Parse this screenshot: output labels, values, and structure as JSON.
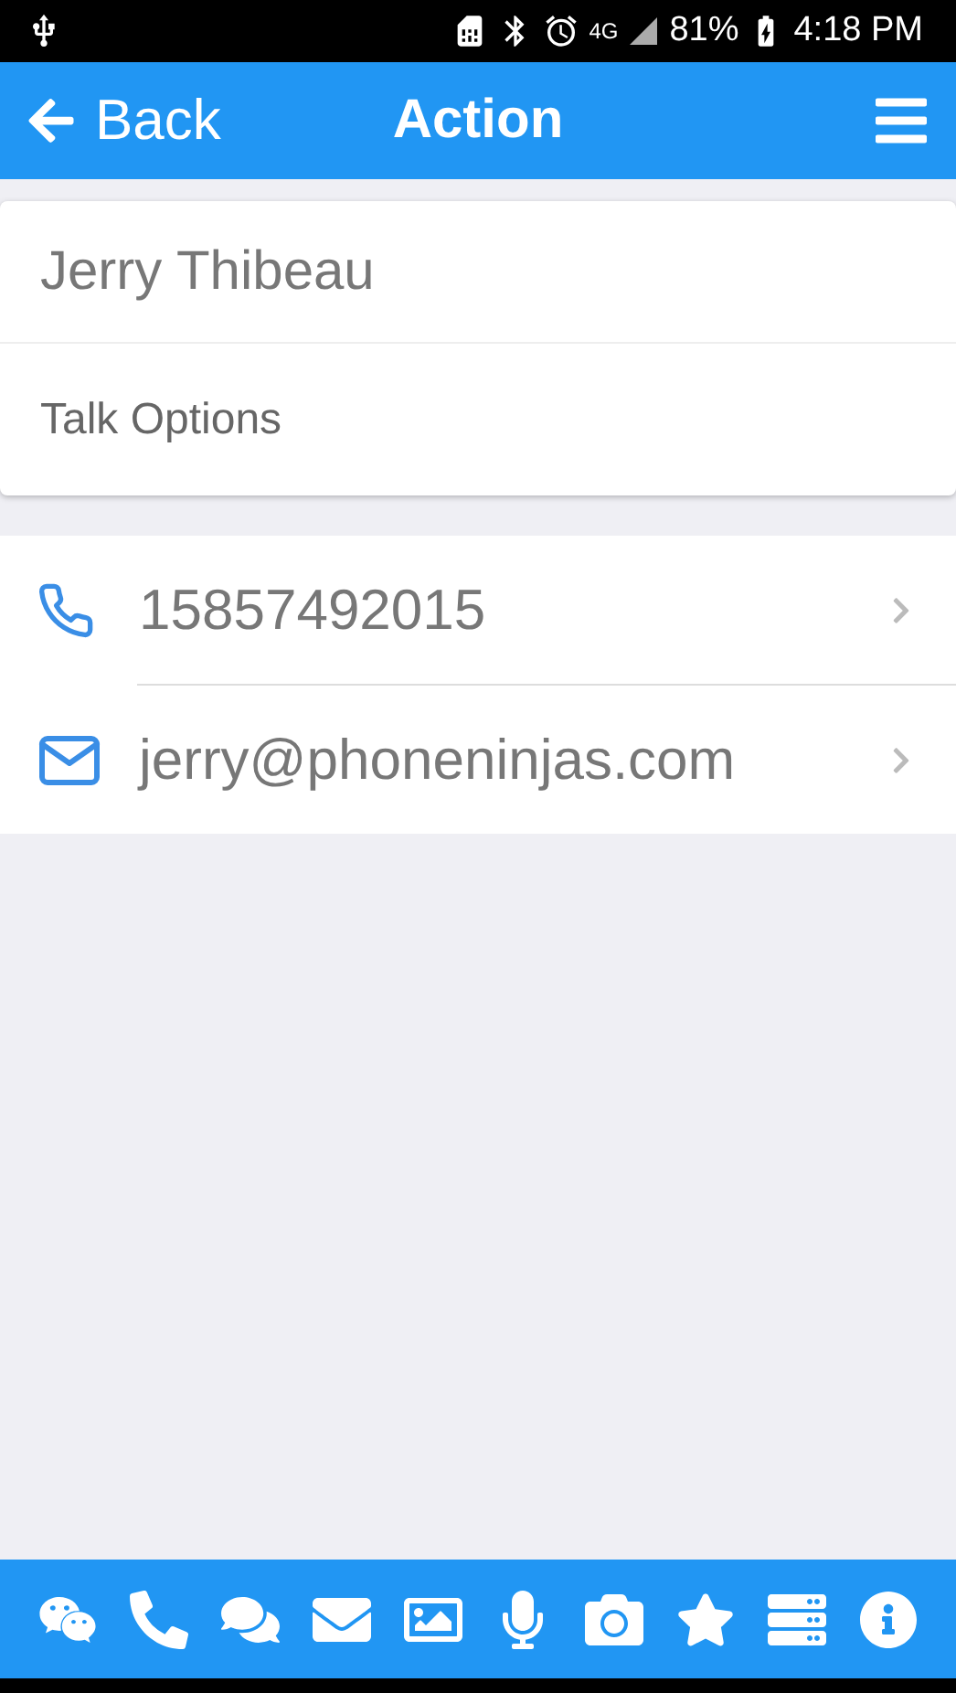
{
  "status_bar": {
    "network": "4G",
    "battery": "81%",
    "time": "4:18 PM"
  },
  "nav_bar": {
    "back": "Back",
    "title": "Action"
  },
  "header_card": {
    "name": "Jerry Thibeau",
    "subtitle": "Talk Options"
  },
  "contacts": [
    {
      "kind": "phone",
      "value": "15857492015"
    },
    {
      "kind": "email",
      "value": "jerry@phoneninjas.com"
    }
  ]
}
